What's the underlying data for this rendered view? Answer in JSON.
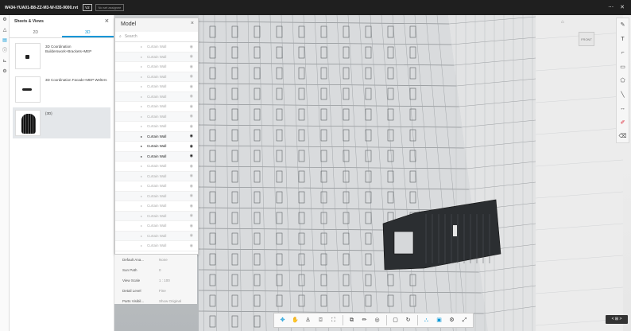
{
  "topbar": {
    "title": "W434-YUA01-B8-ZZ-M3-W-035-9000.rvt",
    "version": "V2",
    "assignee": "No set assignee",
    "more_icon": "ellipsis-icon",
    "close_icon": "close-icon"
  },
  "left_rail": {
    "icons": [
      "settings-icon",
      "layers-icon",
      "sheets-icon",
      "info-icon",
      "measure-icon",
      "gear-icon"
    ]
  },
  "sheets_panel": {
    "title": "Sheets & Views",
    "tabs": [
      {
        "label": "2D",
        "active": false
      },
      {
        "label": "3D",
        "active": true
      }
    ],
    "items": [
      {
        "name": "3D Coordination Builderswork+Brackets+MEP",
        "thumb": "small-blob",
        "selected": false
      },
      {
        "name": "3D Coordination Facade+MEP Welters",
        "thumb": "wide-blob",
        "selected": false
      },
      {
        "name": "{3D}",
        "thumb": "tower",
        "selected": true
      }
    ]
  },
  "model_panel": {
    "title": "Model",
    "search_placeholder": "Search",
    "rows": [
      {
        "label": "Curtain Wall",
        "visible": false
      },
      {
        "label": "Curtain Wall",
        "visible": false
      },
      {
        "label": "Curtain Wall",
        "visible": false
      },
      {
        "label": "Curtain Wall",
        "visible": false
      },
      {
        "label": "Curtain Wall",
        "visible": false
      },
      {
        "label": "Curtain Wall",
        "visible": false
      },
      {
        "label": "Curtain Wall",
        "visible": false
      },
      {
        "label": "Curtain Wall",
        "visible": false
      },
      {
        "label": "Curtain Wall",
        "visible": false
      },
      {
        "label": "Curtain Wall",
        "visible": true
      },
      {
        "label": "Curtain Wall",
        "visible": true
      },
      {
        "label": "Curtain Wall",
        "visible": true
      },
      {
        "label": "Curtain Wall",
        "visible": false
      },
      {
        "label": "Curtain Wall",
        "visible": false
      },
      {
        "label": "Curtain Wall",
        "visible": false
      },
      {
        "label": "Curtain Wall",
        "visible": false
      },
      {
        "label": "Curtain Wall",
        "visible": false
      },
      {
        "label": "Curtain Wall",
        "visible": false
      },
      {
        "label": "Curtain Wall",
        "visible": false
      },
      {
        "label": "Curtain Wall",
        "visible": false
      },
      {
        "label": "Curtain Wall",
        "visible": false
      }
    ]
  },
  "properties": [
    {
      "key": "Default Ana...",
      "value": "None"
    },
    {
      "key": "Sun Path",
      "value": "0"
    },
    {
      "key": "View Scale",
      "value": "1 : 100"
    },
    {
      "key": "Detail Level",
      "value": "Fine"
    },
    {
      "key": "Parts Visibil...",
      "value": "Show Original"
    }
  ],
  "viewcube": {
    "label": "FRONT"
  },
  "right_toolbar": {
    "tools": [
      "markup-icon",
      "text-icon",
      "callout-icon",
      "rectangle-icon",
      "polycloud-icon",
      "line-icon",
      "dimension-icon",
      "pen-icon",
      "eraser-icon"
    ]
  },
  "bottom_toolbar": {
    "tools": [
      "orbit-icon",
      "pan-icon",
      "walk-icon",
      "camera-icon",
      "fit-icon",
      "section-icon",
      "measure-icon",
      "explode-icon",
      "box-icon",
      "sheet-icon",
      "model-browser-icon",
      "properties-icon",
      "settings-icon",
      "fullscreen-icon"
    ]
  },
  "pager": {
    "label": "< ⊞ >"
  },
  "colors": {
    "accent": "#0696d7",
    "topbar": "#1f1f1f",
    "markup_red": "#dd2233"
  }
}
